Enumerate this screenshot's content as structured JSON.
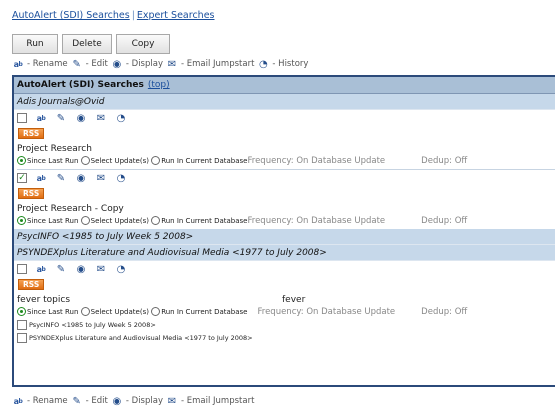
{
  "nav": {
    "autoalert_link": "AutoAlert (SDI) Searches",
    "separator": "|",
    "expert_link": "Expert Searches"
  },
  "toolbar": {
    "run": "Run",
    "delete": "Delete",
    "copy": "Copy"
  },
  "legend": {
    "rename": "- Rename",
    "edit": "- Edit",
    "display": "- Display",
    "email": "- Email Jumpstart",
    "history": "- History"
  },
  "panel": {
    "title": "AutoAlert (SDI) Searches",
    "top_link": "(top)",
    "groups": [
      {
        "databases": [
          "Adis Journals@Ovid"
        ],
        "searches": [
          {
            "name": "Project Research",
            "checked": false,
            "rss": "RSS",
            "opt1": "Since Last Run",
            "opt2": "Select Update(s)",
            "opt3": "Run In Current Database",
            "frequency": "Frequency: On Database Update",
            "dedup": "Dedup: Off"
          },
          {
            "name": "Project Research - Copy",
            "checked": true,
            "rss": "RSS",
            "opt1": "Since Last Run",
            "opt2": "Select Update(s)",
            "opt3": "Run In Current Database",
            "frequency": "Frequency: On Database Update",
            "dedup": "Dedup: Off"
          }
        ]
      },
      {
        "databases": [
          "PsycINFO <1985 to July Week 5 2008>",
          "PSYNDEXplus Literature and Audiovisual Media <1977 to July 2008>"
        ],
        "searches": [
          {
            "name": "fever topics",
            "query": "fever",
            "checked": false,
            "rss": "RSS",
            "opt1": "Since Last Run",
            "opt2": "Select Update(s)",
            "opt3": "Run In Current Database",
            "frequency": "Frequency: On Database Update",
            "dedup": "Dedup: Off",
            "db_options": [
              "PsycINFO <1985 to July Week 5 2008>",
              "PSYNDEXplus Literature and Audiovisual Media <1977 to July 2008>"
            ]
          }
        ]
      }
    ]
  },
  "icons": {
    "rename": "abc-rename-icon",
    "edit": "pencil-icon",
    "display": "eye-icon",
    "email": "email-icon",
    "history": "clock-icon"
  }
}
